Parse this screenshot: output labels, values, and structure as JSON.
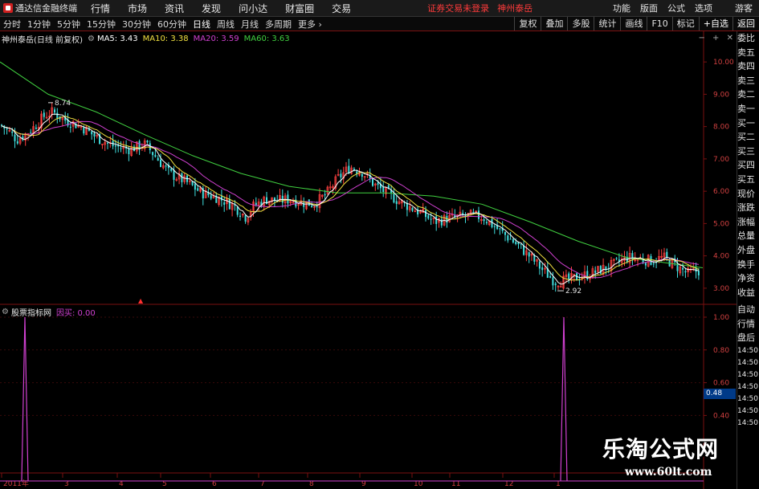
{
  "app": {
    "name": "通达信金融终端",
    "menu": [
      "行情",
      "市场",
      "资讯",
      "发现",
      "问小达",
      "财富圈",
      "交易"
    ],
    "notice": "证券交易未登录",
    "notice_stock": "神州泰岳",
    "right_menu": [
      "功能",
      "版面",
      "公式",
      "选项"
    ],
    "guest": "游客"
  },
  "toolbar": {
    "periods": [
      "分时",
      "1分钟",
      "5分钟",
      "15分钟",
      "30分钟",
      "60分钟",
      "日线",
      "周线",
      "月线",
      "多周期",
      "更多"
    ],
    "active_period": "日线",
    "buttons": [
      "复权",
      "叠加",
      "多股",
      "统计",
      "画线",
      "F10",
      "标记",
      "+自选",
      "返回"
    ]
  },
  "chart": {
    "title": "神州泰岳(日线 前复权)",
    "ma5": "MA5: 3.43",
    "ma10": "MA10: 3.38",
    "ma20": "MA20: 3.59",
    "ma60": "MA60: 3.63",
    "colors": {
      "ma5": "#ffffff",
      "ma10": "#f0e040",
      "ma20": "#d040d0",
      "ma60": "#40d040",
      "up": "#ff4040",
      "down": "#40e0e0",
      "axis": "#d04040"
    }
  },
  "indicator": {
    "name": "股票指标网",
    "value": "因买: 0.00",
    "tag": "0.48"
  },
  "side_panel": {
    "items": [
      "委比",
      "卖五",
      "卖四",
      "卖三",
      "卖二",
      "卖一",
      "买一",
      "买二",
      "买三",
      "买四",
      "买五",
      "现价",
      "涨跌",
      "涨幅",
      "总量",
      "外盘",
      "换手",
      "净资",
      "收益"
    ],
    "items2": [
      "自动",
      "行情",
      "盘后"
    ],
    "times": [
      "14:50",
      "14:50",
      "14:50",
      "14:50",
      "14:50",
      "14:50",
      "14:50"
    ]
  },
  "chart_data": [
    {
      "type": "candlestick",
      "title": "神州泰岳(日线 前复权)",
      "y_ticks": [
        "10.00",
        "9.00",
        "8.00",
        "7.00",
        "6.00",
        "5.00",
        "4.00",
        "3.00"
      ],
      "ylim": [
        2.6,
        10.6
      ],
      "x_ticks": [
        "2011年",
        "3",
        "4",
        "5",
        "6",
        "7",
        "8",
        "9",
        "10",
        "11",
        "12",
        "1"
      ],
      "annotations": [
        {
          "text": "8.74",
          "value": 8.74
        },
        {
          "text": "2.92",
          "value": 2.92
        }
      ],
      "series": [
        {
          "name": "MA5",
          "last": 3.43
        },
        {
          "name": "MA10",
          "last": 3.38
        },
        {
          "name": "MA20",
          "last": 3.59
        },
        {
          "name": "MA60",
          "last": 3.63
        }
      ],
      "price_path": [
        [
          0,
          8.05
        ],
        [
          10,
          7.85
        ],
        [
          20,
          7.6
        ],
        [
          30,
          7.75
        ],
        [
          40,
          7.95
        ],
        [
          55,
          8.35
        ],
        [
          65,
          8.45
        ],
        [
          80,
          8.2
        ],
        [
          100,
          8.0
        ],
        [
          120,
          7.65
        ],
        [
          140,
          7.4
        ],
        [
          160,
          7.3
        ],
        [
          180,
          7.45
        ],
        [
          195,
          7.0
        ],
        [
          210,
          6.55
        ],
        [
          230,
          6.3
        ],
        [
          250,
          5.95
        ],
        [
          270,
          5.8
        ],
        [
          290,
          5.55
        ],
        [
          305,
          5.2
        ],
        [
          315,
          5.55
        ],
        [
          330,
          5.75
        ],
        [
          345,
          5.7
        ],
        [
          360,
          5.75
        ],
        [
          375,
          5.65
        ],
        [
          390,
          5.6
        ],
        [
          405,
          5.9
        ],
        [
          420,
          6.4
        ],
        [
          435,
          6.75
        ],
        [
          450,
          6.6
        ],
        [
          465,
          6.2
        ],
        [
          480,
          5.95
        ],
        [
          495,
          5.7
        ],
        [
          510,
          5.5
        ],
        [
          525,
          5.3
        ],
        [
          540,
          5.05
        ],
        [
          555,
          5.15
        ],
        [
          570,
          5.2
        ],
        [
          585,
          5.25
        ],
        [
          600,
          5.2
        ],
        [
          615,
          4.9
        ],
        [
          630,
          4.6
        ],
        [
          645,
          4.3
        ],
        [
          660,
          3.95
        ],
        [
          675,
          3.55
        ],
        [
          690,
          3.2
        ],
        [
          705,
          3.25
        ],
        [
          720,
          3.35
        ],
        [
          735,
          3.45
        ],
        [
          750,
          3.6
        ],
        [
          765,
          3.75
        ],
        [
          780,
          3.95
        ],
        [
          795,
          3.9
        ],
        [
          810,
          3.85
        ],
        [
          825,
          3.95
        ],
        [
          840,
          3.7
        ],
        [
          855,
          3.45
        ],
        [
          870,
          3.55
        ]
      ]
    },
    {
      "type": "line",
      "series": [
        {
          "name": "因买",
          "last": 0.0
        }
      ],
      "y_ticks": [
        "1.00",
        "0.80",
        "0.60",
        "0.40"
      ],
      "ylim": [
        0,
        1.0
      ],
      "spikes": [
        {
          "x_label": "2011年",
          "value": 1.0
        },
        {
          "x_label": "1",
          "value": 1.0
        }
      ]
    }
  ]
}
